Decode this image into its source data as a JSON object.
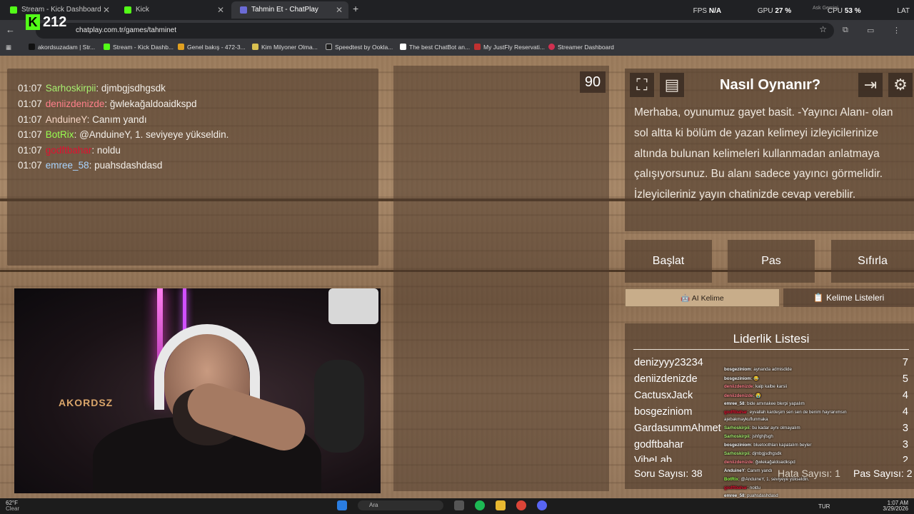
{
  "tabs": [
    {
      "label": "Stream - Kick Dashboard",
      "color": "#53fc18",
      "active": false
    },
    {
      "label": "Kick",
      "color": "#53fc18",
      "active": false
    },
    {
      "label": "Tahmin Et - ChatPlay",
      "color": "#6b6bd6",
      "active": true
    }
  ],
  "url": "chatplay.com.tr/games/tahminet",
  "kick_viewers": "212",
  "overlay": {
    "fps_label": "FPS",
    "fps_value": "N/A",
    "gpu_label": "GPU",
    "gpu_value": "27 %",
    "cpu_label": "CPU",
    "cpu_value": "53 %",
    "lat_label": "LAT",
    "faded_text": "Ask Gemini"
  },
  "bookmarks": [
    {
      "label": "akordsuzadam | Str...",
      "color": "#111111"
    },
    {
      "label": "Stream - Kick Dashb...",
      "color": "#53fc18"
    },
    {
      "label": "Genel bakış - 472-3...",
      "color": "#e0a020"
    },
    {
      "label": "Kim Milyoner Olma...",
      "color": "#d8c050"
    },
    {
      "label": "Speedtest by Ookla...",
      "color": "#202020"
    },
    {
      "label": "The best ChatBot an...",
      "color": "#ffffff"
    },
    {
      "label": "My JustFly Reservati...",
      "color": "#c03030"
    },
    {
      "label": "Streamer Dashboard",
      "color": "#d03050"
    }
  ],
  "chat": [
    {
      "time": "01:07",
      "user": "Sarhoskirpii",
      "color": "#a8f070",
      "msg": ": djmbgjsdhgsdk"
    },
    {
      "time": "01:07",
      "user": "deniizdenizde",
      "color": "#ff7f8a",
      "msg": ": ğwlekağaldoaidkspd"
    },
    {
      "time": "01:07",
      "user": "AnduineY",
      "color": "#f6d6c6",
      "msg": ": Canım yandı"
    },
    {
      "time": "01:07",
      "user": "BotRix",
      "color": "#98ff50",
      "msg": ": @AnduineY, 1. seviyeye yükseldin."
    },
    {
      "time": "01:07",
      "user": "godftbahar",
      "color": "#e01030",
      "msg": ": noldu"
    },
    {
      "time": "01:07",
      "user": "emree_58",
      "color": "#a8d4ff",
      "msg": ": puahsdashdasd"
    }
  ],
  "webcam_label": "AKORDSZ",
  "timer": "90",
  "how": {
    "title": "Nasıl Oynanır?",
    "text": "Merhaba, oyunumuz gayet basit. -Yayıncı Alanı- olan sol altta ki bölüm de yazan kelimeyi izleyicilerinize altında bulunan kelimeleri kullanmadan anlatmaya çalışıyorsunuz. Bu alanı sadece yayıncı görmelidir. İzleyicileriniz yayın chatinizde cevap verebilir."
  },
  "buttons": {
    "start": "Başlat",
    "pass": "Pas",
    "reset": "Sıfırla"
  },
  "word_tabs": {
    "ai": "AI Kelime",
    "lists": "Kelime Listeleri"
  },
  "leaderboard": {
    "title": "Liderlik Listesi",
    "rows": [
      {
        "name": "denizyyy23234",
        "score": "7"
      },
      {
        "name": "deniizdenizde",
        "score": "5"
      },
      {
        "name": "CactusxJack",
        "score": "4"
      },
      {
        "name": "bosgeziniom",
        "score": "4"
      },
      {
        "name": "GardasummAhmet",
        "score": "3"
      },
      {
        "name": "godftbahar",
        "score": "3"
      },
      {
        "name": "VibeLab",
        "score": "2"
      }
    ],
    "questions": "Soru Sayısı: 38",
    "errors": "Hata Sayısı: 1",
    "passes": "Pas Sayısı: 2"
  },
  "obs_chat": [
    {
      "user": "bosgeziniom",
      "color": "#ffffff",
      "msg": ": aynanda admisdide"
    },
    {
      "user": "bosgeziniom",
      "color": "#ffffff",
      "msg": ": 😂"
    },
    {
      "user": "deniizdenizde",
      "color": "#ff7f8a",
      "msg": ": kalp kalbe karsii"
    },
    {
      "user": "deniizdenizde",
      "color": "#ff7f8a",
      "msg": ": 😭"
    },
    {
      "user": "emree_58",
      "color": "#ffffff",
      "msg": ": bide amınakee blerpi yapalım"
    },
    {
      "user": "godftbahar",
      "color": "#e01030",
      "msg": ": eyvallah kardeşim sen sen de benim hayranımsın"
    },
    {
      "user": "",
      "color": "#ffffff",
      "msg": "ajebakmaykuflunmaka"
    },
    {
      "user": "Sarhoskirpii",
      "color": "#a8f070",
      "msg": ": bu kadar aynı olmayalım"
    },
    {
      "user": "Sarhoskirpii",
      "color": "#a8f070",
      "msg": ": jshfghjfsgh"
    },
    {
      "user": "bosgeziniom",
      "color": "#ffffff",
      "msg": ": bluetoothları kapatalım beyler"
    },
    {
      "user": "Sarhoskirpii",
      "color": "#a8f070",
      "msg": ": djmbgjsdhgsdk"
    },
    {
      "user": "deniizdenizde",
      "color": "#ff7f8a",
      "msg": ": ğwlekağaldoaidkspd"
    },
    {
      "user": "AnduineY",
      "color": "#ffffff",
      "msg": ": Canım yandı"
    },
    {
      "user": "BotRix",
      "color": "#98ff50",
      "msg": ": @AnduineY, 1. seviyeye yükseldin."
    },
    {
      "user": "godftbahar",
      "color": "#e01030",
      "msg": ": noldu"
    },
    {
      "user": "emree_58",
      "color": "#ffffff",
      "msg": ": puahsdashdasd"
    }
  ],
  "taskbar": {
    "temp": "62°F",
    "weather": "Clear",
    "search": "Ara",
    "lang": "TUR",
    "time": "1:07 AM",
    "date": "3/29/2026"
  }
}
